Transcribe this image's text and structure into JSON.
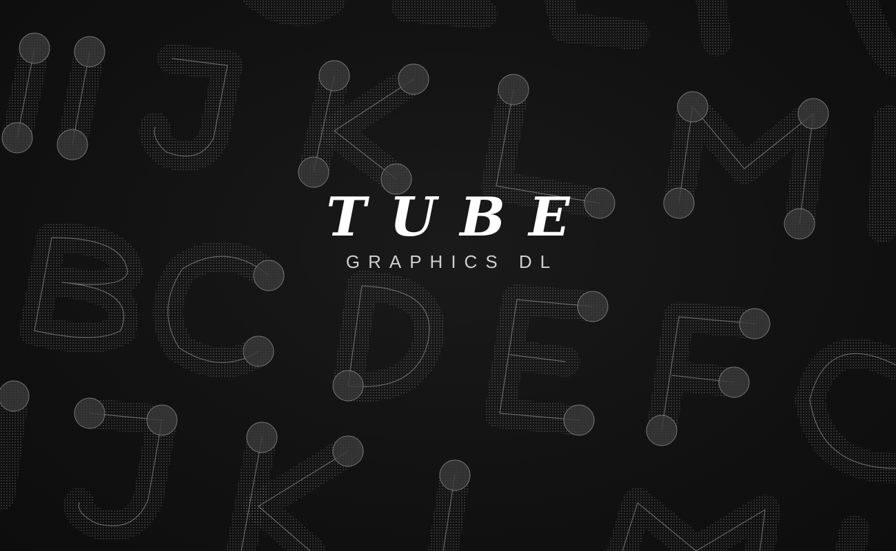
{
  "title": "TUBE",
  "subtitle": "GRAPHICS DL",
  "background": {
    "description_icon": "tube-letter-pattern",
    "color": "#121212",
    "stroke_color": "#bdbdbd"
  }
}
